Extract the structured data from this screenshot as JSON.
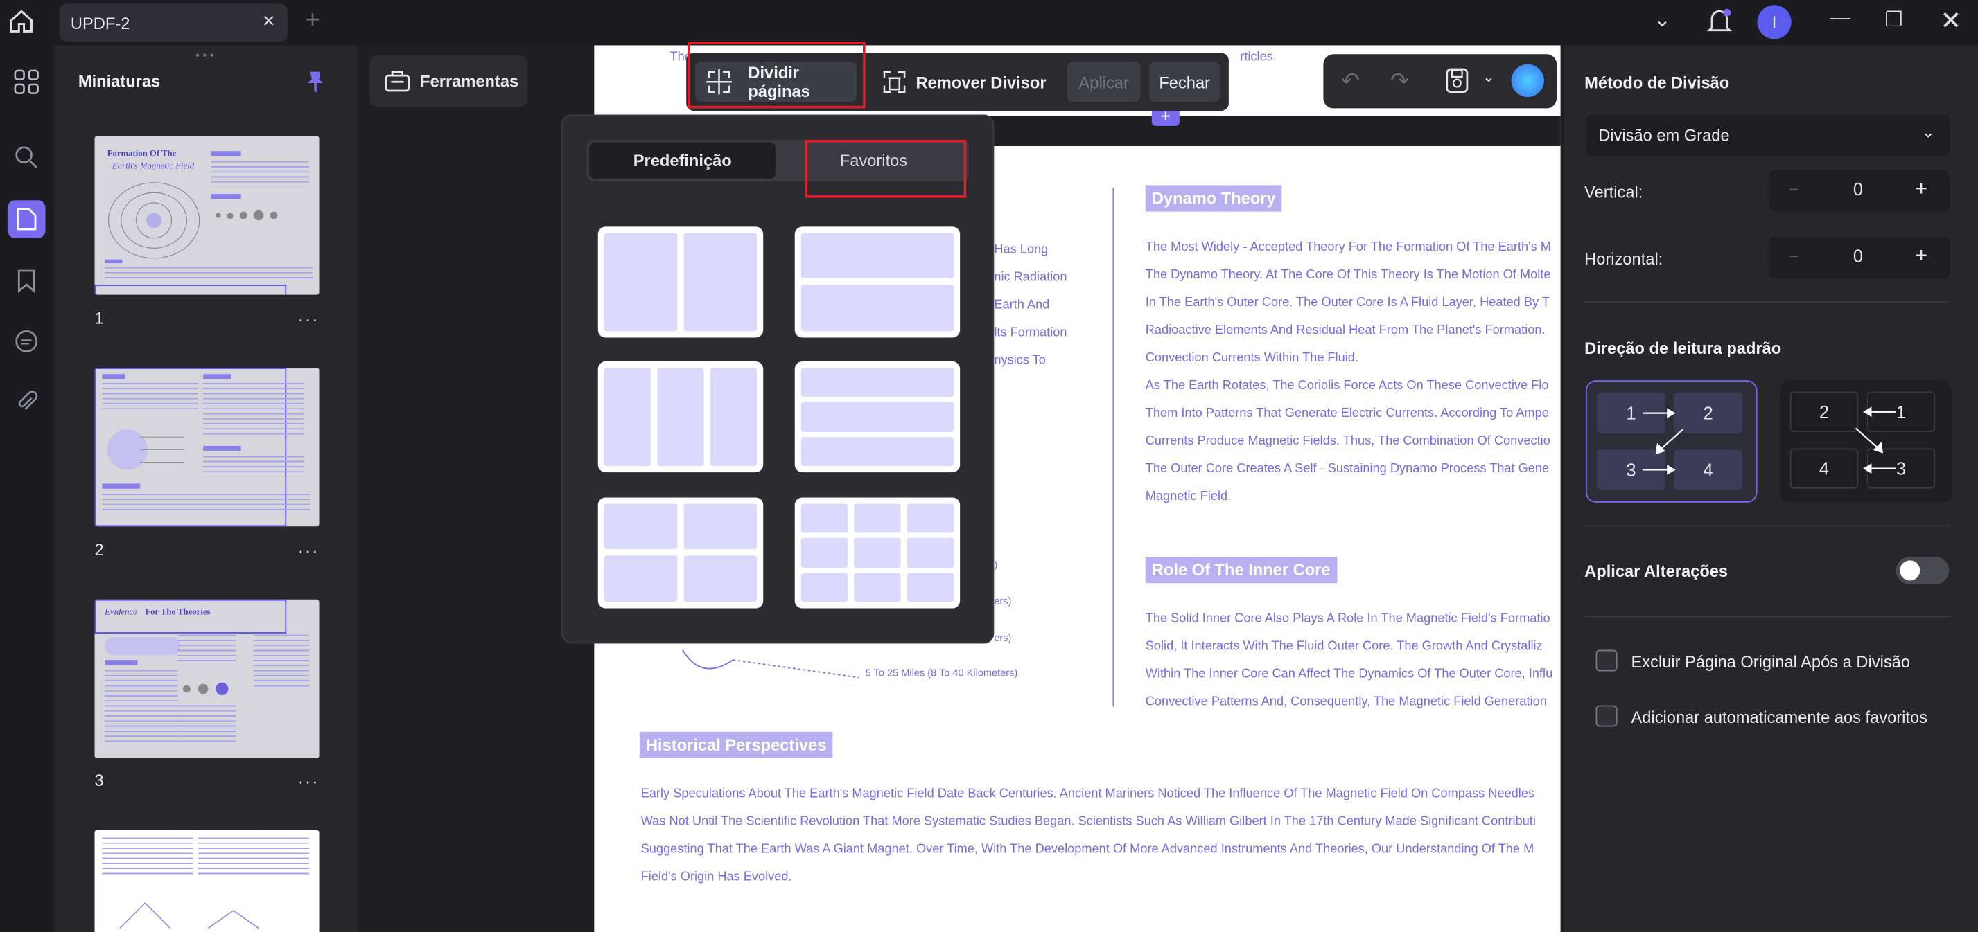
{
  "window": {
    "tab_title": "UPDF-2",
    "avatar_letter": "I"
  },
  "thumbnails": {
    "title": "Miniaturas",
    "pages": [
      {
        "number": "1",
        "heading_a": "Formation Of The",
        "heading_b": "Earth's Magnetic Field"
      },
      {
        "number": "2"
      },
      {
        "number": "3",
        "heading_a": "Evidence",
        "heading_b": "For The Theories"
      },
      {
        "number": ""
      }
    ],
    "more_label": "···"
  },
  "tools": {
    "label": "Ferramentas"
  },
  "split_toolbar": {
    "split_label": "Dividir páginas",
    "remove_label": "Remover Divisor",
    "apply_label": "Aplicar",
    "close_label": "Fechar"
  },
  "popup": {
    "tab_preset": "Predefinição",
    "tab_favorites": "Favoritos"
  },
  "document": {
    "top_fragment_left": "The",
    "top_fragment_right": "rticles.",
    "left_fragments": [
      "Has Long",
      "nic Radiation",
      "Earth And",
      "lts Formation",
      "nysics To"
    ],
    "left_small": [
      ")",
      "ers)",
      "ers)",
      "5 To 25 Miles (8 To 40 Kilometers)"
    ],
    "dynamo": {
      "heading": "Dynamo Theory",
      "lines": [
        "The Most Widely - Accepted Theory For The Formation Of The Earth's M",
        "The Dynamo Theory. At The Core Of This Theory Is The Motion Of Molte",
        "In The Earth's Outer Core. The Outer Core Is A Fluid Layer, Heated By T",
        "Radioactive Elements And Residual Heat From The Planet's Formation.",
        "Convection Currents Within The Fluid.",
        "As The Earth Rotates, The Coriolis Force Acts On These Convective Flo",
        "Them Into Patterns That Generate Electric Currents. According To Ampe",
        "Currents Produce Magnetic Fields. Thus, The Combination Of Convectio",
        "The Outer Core Creates A Self - Sustaining Dynamo Process That Gene",
        "Magnetic Field."
      ]
    },
    "inner_core": {
      "heading": "Role Of The Inner Core",
      "lines": [
        "The Solid Inner Core Also Plays A Role In The Magnetic Field's Formatio",
        "Solid, It Interacts With The Fluid Outer Core. The Growth And Crystalliz",
        "Within The Inner Core Can Affect The Dynamics Of The Outer Core, Influ",
        "Convective Patterns And, Consequently, The Magnetic Field Generation"
      ]
    },
    "historical": {
      "heading": "Historical Perspectives",
      "lines": [
        "Early Speculations About The Earth's Magnetic Field Date Back Centuries. Ancient Mariners Noticed The Influence Of The Magnetic Field On Compass Needles",
        "Was Not Until The Scientific Revolution That More Systematic Studies Began. Scientists Such As William Gilbert In The 17th Century Made Significant Contributi",
        "Suggesting That The Earth Was A Giant Magnet. Over Time, With The Development Of More Advanced Instruments And Theories, Our Understanding Of The M",
        "Field's Origin Has Evolved."
      ]
    }
  },
  "right_panel": {
    "method_title": "Método de Divisão",
    "method_value": "Divisão em Grade",
    "vertical_label": "Vertical:",
    "vertical_value": "0",
    "horizontal_label": "Horizontal:",
    "horizontal_value": "0",
    "reading_title": "Direção de leitura padrão",
    "ltr_cells": [
      "1",
      "2",
      "3",
      "4"
    ],
    "rtl_cells": [
      "2",
      "1",
      "4",
      "3"
    ],
    "apply_changes_label": "Aplicar Alterações",
    "exclude_original_label": "Excluir Página Original Após a Divisão",
    "add_favorites_label": "Adicionar automaticamente aos favoritos",
    "minus": "−",
    "plus": "+"
  },
  "colors": {
    "accent": "#7a6cf0",
    "highlight_red": "#e01e2a",
    "doc_text": "#7a6ce0"
  }
}
